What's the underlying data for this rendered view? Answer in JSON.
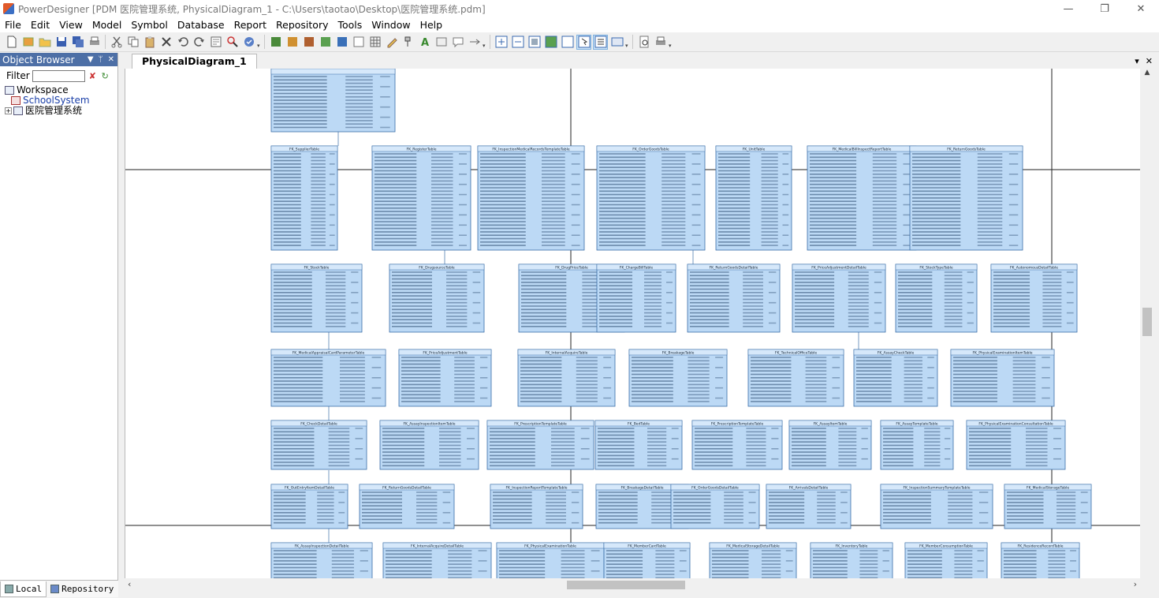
{
  "window": {
    "title": "PowerDesigner [PDM 医院管理系统, PhysicalDiagram_1 - C:\\Users\\taotao\\Desktop\\医院管理系统.pdm]",
    "controls": [
      "—",
      "❐",
      "✕"
    ]
  },
  "menu": [
    "File",
    "Edit",
    "View",
    "Model",
    "Symbol",
    "Database",
    "Report",
    "Repository",
    "Tools",
    "Window",
    "Help"
  ],
  "browser": {
    "title": "Object Browser",
    "filter_label": "Filter",
    "tree": [
      {
        "label": "Workspace"
      },
      {
        "label": "SchoolSystem"
      },
      {
        "label": "医院管理系统"
      }
    ],
    "tabs": [
      "Local",
      "Repository"
    ]
  },
  "diagram": {
    "tab_label": "PhysicalDiagram_1",
    "top_block": "Field list rows",
    "rows": [
      [
        "FK_SupplierTable",
        "FK_RegisterTable",
        "FK_InspectionMedicalRecordsTemplateTable",
        "FK_OrderGoodsTable",
        "FK_UnitTable",
        "FK_MedicalBillInspectReportTable",
        "FK_ReturnGoodsTable"
      ],
      [
        "FK_StockTable",
        "FK_DrugsourceTable",
        "FK_DrugPriceTable",
        "FK_ChargeBillTable",
        "FK_ReturnGoodsDetailTable",
        "FK_PriceAdjustmentDetailTable",
        "FK_StockTypeTable",
        "FK_AutonomousDetailTable"
      ],
      [
        "FK_MedicalAppraisalCardParameterTable",
        "FK_PriceAdjustmentTable",
        "FK_InternalAcquireTable",
        "FK_BreakageTable",
        "FK_TechnicalOfficeTable",
        "FK_AssayCheckTable",
        "FK_PhysicalExaminationItemTable"
      ],
      [
        "FK_CheckDetailTable",
        "FK_AssayInspectionItemTable",
        "FK_PrescriptionTemplateTable",
        "FK_BedTable",
        "FK_PrescriptionTemplateTable",
        "FK_AssayItemTable",
        "FK_AssayTemplateTable",
        "FK_PhysicalExaminationConsultationTable"
      ],
      [
        "FK_OutEntryItemDetailTable",
        "FK_ReturnGoodsDetailTable",
        "FK_InspectionReportTemplateTable",
        "FK_BreakageDetailTable",
        "FK_OrderGoodsDetailTable",
        "FK_ArrivalsDetailTable",
        "FK_InspectionSummaryTemplateTable",
        "FK_MedicalStorageTable"
      ],
      [
        "FK_AssayInspectionDetailTable",
        "FK_InternalAcquireDetailTable",
        "FK_PhysicalExaminationTable",
        "FK_MemberCardTable",
        "FK_MedicalStorageDetailTable",
        "FK_InventoryTable",
        "FK_MemberConsumptionTable",
        "FK_ResidenceRecordTable"
      ]
    ]
  }
}
